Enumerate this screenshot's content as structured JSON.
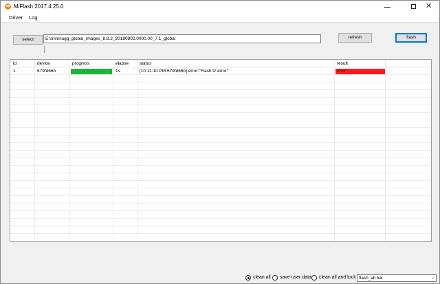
{
  "window": {
    "title": "MiFlash 2017.4.25.0",
    "icon": "mi-logo",
    "icon_text": "mi"
  },
  "menu": {
    "items": [
      {
        "label": "Driver"
      },
      {
        "label": "Log"
      }
    ]
  },
  "toolbar": {
    "select_label": "select",
    "path_value": "E:\\mimi\\ugg_global_images_8.8.2_20180802.0000.00_7.1_global",
    "refresh_label": "refresh",
    "flash_label": "flash"
  },
  "table": {
    "columns": [
      "id",
      "device",
      "progress",
      "elapse",
      "status",
      "result"
    ],
    "rows": [
      {
        "id": "1",
        "device": "679fd66b",
        "progress": 1.0,
        "elapse": "1s",
        "status": "[10:11:10 PM  679fd66b]:error:\"Flash tz error\"",
        "result": "error",
        "result_color": "#ff1a1a",
        "progress_color": "#1fb33a"
      }
    ]
  },
  "footer": {
    "options": [
      {
        "label": "clean all",
        "checked": true
      },
      {
        "label": "save user data",
        "checked": false
      },
      {
        "label": "clean all and lock",
        "checked": false
      }
    ],
    "script_select": "flash_all.bat"
  }
}
